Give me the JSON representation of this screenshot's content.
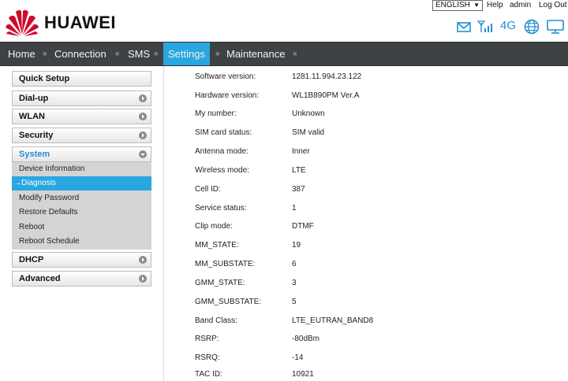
{
  "header": {
    "brand": "HUAWEI",
    "language": "ENGLISH",
    "links": [
      "Help",
      "admin",
      "Log Out"
    ],
    "network_type": "4G",
    "icons": [
      "mail-icon",
      "signal-icon",
      "globe-icon",
      "monitor-icon"
    ],
    "accent_color": "#28a7e1",
    "logo_color": "#cf0a2c"
  },
  "nav": {
    "items": [
      {
        "label": "Home"
      },
      {
        "label": "Connection"
      },
      {
        "label": "SMS"
      },
      {
        "label": "Settings",
        "active": true
      },
      {
        "label": "Maintenance"
      }
    ]
  },
  "sidebar": {
    "sections": [
      {
        "label": "Quick Setup"
      },
      {
        "label": "Dial-up"
      },
      {
        "label": "WLAN"
      },
      {
        "label": "Security"
      },
      {
        "label": "System",
        "expanded": true
      },
      {
        "label": "DHCP"
      },
      {
        "label": "Advanced"
      }
    ],
    "system_items": [
      {
        "label": "Device Information"
      },
      {
        "label": "→Diagnosis",
        "active": true
      },
      {
        "label": "Modify Password"
      },
      {
        "label": "Restore Defaults"
      },
      {
        "label": "Reboot"
      },
      {
        "label": "Reboot Schedule"
      }
    ]
  },
  "info": [
    {
      "label": "Software version:",
      "value": "1281.11.994.23.122"
    },
    {
      "label": "Hardware version:",
      "value": "WL1B890PM Ver.A"
    },
    {
      "label": "My number:",
      "value": "Unknown"
    },
    {
      "label": "SIM card status:",
      "value": "SIM valid"
    },
    {
      "label": "Antenna mode:",
      "value": "Inner"
    },
    {
      "label": "Wireless mode:",
      "value": "LTE"
    },
    {
      "label": "Cell ID:",
      "value": "387"
    },
    {
      "label": "Service status:",
      "value": "1"
    },
    {
      "label": "Clip mode:",
      "value": "DTMF"
    },
    {
      "label": "MM_STATE:",
      "value": "19"
    },
    {
      "label": "MM_SUBSTATE:",
      "value": "6"
    },
    {
      "label": "GMM_STATE:",
      "value": "3"
    },
    {
      "label": "GMM_SUBSTATE:",
      "value": "5"
    },
    {
      "label": "Band Class:",
      "value": "LTE_EUTRAN_BAND8"
    },
    {
      "label": "RSRP:",
      "value": "-80dBm"
    },
    {
      "label": "RSRQ:",
      "value": "-14"
    },
    {
      "label": "TAC ID:",
      "value": "10921"
    }
  ]
}
